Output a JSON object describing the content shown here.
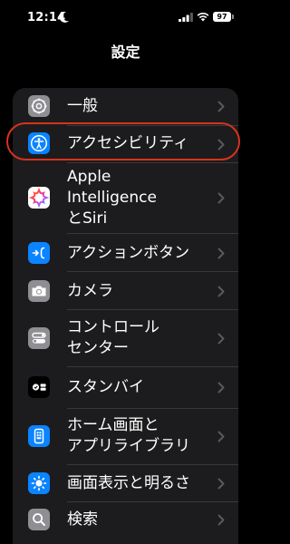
{
  "status_bar": {
    "time": "12:14",
    "battery": "97"
  },
  "nav": {
    "title": "設定"
  },
  "settings": {
    "items": [
      {
        "label": "一般",
        "icon": "gear-icon",
        "icon_bg": "#8e8e93"
      },
      {
        "label": "アクセシビリティ",
        "icon": "accessibility-icon",
        "icon_bg": "#0a84ff"
      },
      {
        "label_lines": [
          "Apple",
          "Intelligence",
          "とSiri"
        ],
        "icon": "apple-intelligence-icon",
        "icon_bg": "#ffffff"
      },
      {
        "label": "アクションボタン",
        "icon": "action-button-icon",
        "icon_bg": "#0a84ff"
      },
      {
        "label": "カメラ",
        "icon": "camera-icon",
        "icon_bg": "#8e8e93"
      },
      {
        "label_lines": [
          "コントロール",
          "センター"
        ],
        "icon": "control-center-icon",
        "icon_bg": "#8e8e93"
      },
      {
        "label": "スタンバイ",
        "icon": "standby-icon",
        "icon_bg": "#000000"
      },
      {
        "label_lines": [
          "ホーム画面と",
          "アプリライブラリ"
        ],
        "icon": "home-screen-icon",
        "icon_bg": "#0a84ff"
      },
      {
        "label": "画面表示と明るさ",
        "icon": "brightness-icon",
        "icon_bg": "#0a84ff"
      },
      {
        "label": "検索",
        "icon": "search-icon",
        "icon_bg": "#8e8e93"
      }
    ]
  },
  "annotation": {
    "highlight_color": "#d8321c",
    "highlighted_item": "アクセシビリティ"
  }
}
